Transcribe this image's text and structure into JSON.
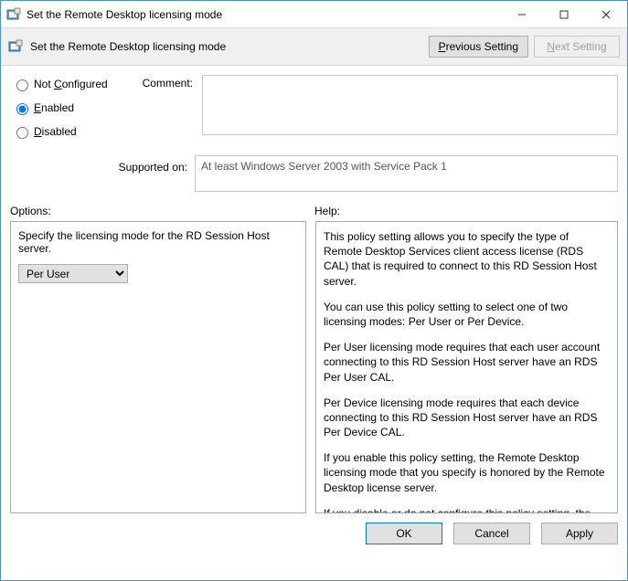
{
  "window": {
    "title": "Set the Remote Desktop licensing mode"
  },
  "toolbar": {
    "title": "Set the Remote Desktop licensing mode",
    "prev_label": "Previous Setting",
    "next_label": "Next Setting"
  },
  "radios": {
    "not_configured": "Not Configured",
    "enabled": "Enabled",
    "disabled": "Disabled",
    "selected": "enabled"
  },
  "comment": {
    "label": "Comment:",
    "value": ""
  },
  "supported": {
    "label": "Supported on:",
    "value": "At least Windows Server 2003 with Service Pack 1"
  },
  "sections": {
    "options_label": "Options:",
    "help_label": "Help:"
  },
  "options": {
    "prompt": "Specify the licensing mode for the RD Session Host server.",
    "dropdown_value": "Per User"
  },
  "help": {
    "p1": "This policy setting allows you to specify the type of Remote Desktop Services client access license (RDS CAL) that is required to connect to this RD Session Host server.",
    "p2": "You can use this policy setting to select one of two licensing modes: Per User or Per Device.",
    "p3": "Per User licensing mode requires that each user account connecting to this RD Session Host server have an RDS Per User CAL.",
    "p4": "Per Device licensing mode requires that each device connecting to this RD Session Host server have an RDS Per Device CAL.",
    "p5": "If you enable this policy setting, the Remote Desktop licensing mode that you specify is honored by the Remote Desktop license server.",
    "p6": "If you disable or do not configure this policy setting, the licensing mode is not specified at the Group Policy level."
  },
  "footer": {
    "ok": "OK",
    "cancel": "Cancel",
    "apply": "Apply"
  }
}
